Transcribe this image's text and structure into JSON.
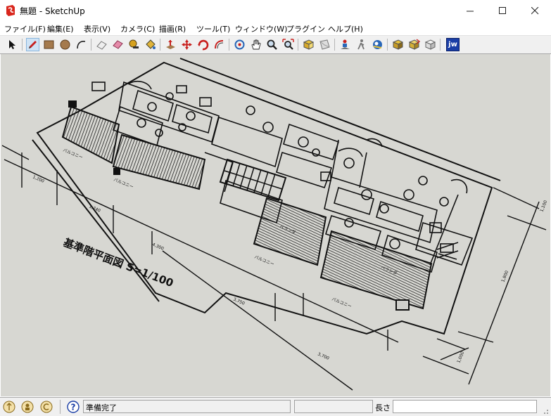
{
  "window": {
    "title": "無題 - SketchUp",
    "minimize": "—",
    "maximize": "☐",
    "close": "✕"
  },
  "menu": [
    {
      "label": "ファイル(F)",
      "name": "menu-file"
    },
    {
      "label": "編集(E)",
      "name": "menu-edit"
    },
    {
      "label": "表示(V)",
      "name": "menu-view"
    },
    {
      "label": "カメラ(C)",
      "name": "menu-camera"
    },
    {
      "label": "描画(R)",
      "name": "menu-draw"
    },
    {
      "label": "ツール(T)",
      "name": "menu-tools"
    },
    {
      "label": "ウィンドウ(W)",
      "name": "menu-window"
    },
    {
      "label": "プラグイン",
      "name": "menu-plugins"
    },
    {
      "label": "ヘルプ(H)",
      "name": "menu-help"
    }
  ],
  "toolbar": {
    "jw_label": "jw",
    "tools": [
      "select-tool",
      "pencil-tool",
      "rectangle-tool",
      "circle-tool",
      "arc-tool",
      "eraser-tool",
      "paint-bucket-tool",
      "tape-measure-tool",
      "pushpull-tool",
      "move-tool",
      "rotate-tool",
      "offset-tool",
      "orbit-tool",
      "pan-tool",
      "zoom-tool",
      "zoom-extents-tool",
      "previous-view-tool",
      "next-view-tool",
      "position-camera-tool",
      "walk-tool",
      "look-around-tool",
      "get-models-tool",
      "share-model-tool",
      "share-component-tool",
      "jw-import-tool"
    ]
  },
  "drawing": {
    "title_text": "基準階平面図  S=1/100",
    "dims": [
      "1,200",
      "1,740",
      "4,300",
      "3,750",
      "3,700",
      "1,800",
      "1,000",
      "1,100"
    ],
    "room_labels": [
      "バルコニー",
      "バルコニー",
      "バルコニー",
      "バルコニー",
      "ベランダ",
      "ベランダ"
    ]
  },
  "status": {
    "message": "準備完了",
    "length_label": "長さ",
    "length_value": ""
  }
}
